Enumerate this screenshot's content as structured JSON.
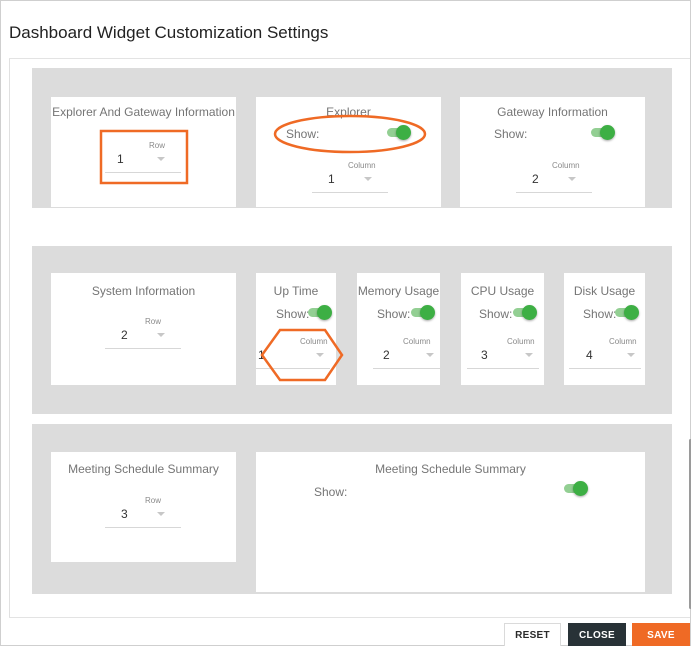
{
  "dialog": {
    "title": "Dashboard Widget Customization Settings"
  },
  "row1": {
    "group": {
      "title": "Explorer And Gateway Information",
      "row_label": "Row",
      "row_value": "1"
    },
    "explorer": {
      "title": "Explorer",
      "show_label": "Show:",
      "column_label": "Column",
      "column_value": "1",
      "show_on": true
    },
    "gateway": {
      "title": "Gateway Information",
      "show_label": "Show:",
      "column_label": "Column",
      "column_value": "2",
      "show_on": true
    }
  },
  "row2": {
    "group": {
      "title": "System Information",
      "row_label": "Row",
      "row_value": "2"
    },
    "uptime": {
      "title": "Up Time",
      "show_label": "Show:",
      "column_label": "Column",
      "column_value": "1",
      "show_on": true
    },
    "memory": {
      "title": "Memory Usage",
      "show_label": "Show:",
      "column_label": "Column",
      "column_value": "2",
      "show_on": true
    },
    "cpu": {
      "title": "CPU Usage",
      "show_label": "Show:",
      "column_label": "Column",
      "column_value": "3",
      "show_on": true
    },
    "disk": {
      "title": "Disk Usage",
      "show_label": "Show:",
      "column_label": "Column",
      "column_value": "4",
      "show_on": true
    }
  },
  "row3": {
    "group": {
      "title": "Meeting Schedule Summary",
      "row_label": "Row",
      "row_value": "3"
    },
    "meeting": {
      "title": "Meeting Schedule Summary",
      "show_label": "Show:",
      "show_on": true
    }
  },
  "footer": {
    "reset_label": "RESET",
    "close_label": "CLOSE",
    "save_label": "SAVE"
  },
  "colors": {
    "accent": "#ef6a25",
    "toggle_on": "#3daf44",
    "toggle_track": "#93cf93",
    "close_button": "#283237",
    "section_bg": "#dcdcdc"
  }
}
